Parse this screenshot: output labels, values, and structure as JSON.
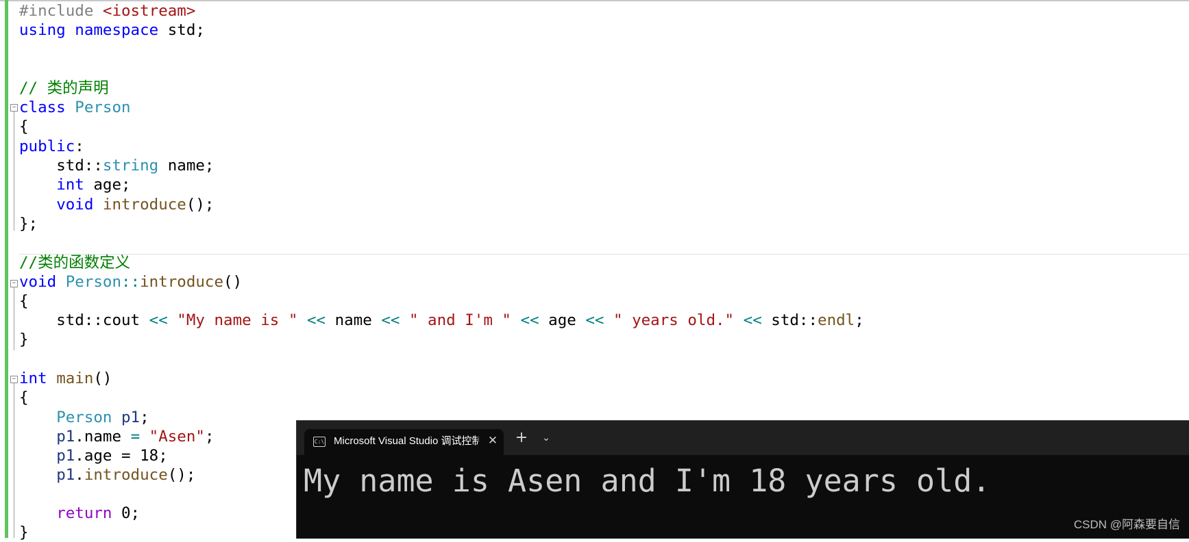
{
  "code": {
    "include_directive": "#include",
    "include_header": "<iostream>",
    "using_kw": "using",
    "namespace_kw": "namespace",
    "using_rest": " std;",
    "comment_decl": "// 类的声明",
    "class_kw": "class",
    "class_name": "Person",
    "brace_open": "{",
    "brace_close": "}",
    "class_end": "};",
    "public_kw": "public",
    "colon": ":",
    "std_prefix": "std::",
    "string_type": "string",
    "member_name": " name;",
    "int_kw": "int",
    "member_age": " age;",
    "void_kw": "void",
    "introduce_fn": "introduce",
    "call_parens": "();",
    "comment_def": "//类的函数定义",
    "scope_op": "::",
    "parens": "()",
    "cout_prefix": "std::cout ",
    "shift_op": "<<",
    "str_myname": "\"My name is \"",
    "name_ref": " name ",
    "str_and": "\" and I'm \"",
    "age_ref": " age ",
    "str_years": "\" years old.\"",
    "endl_fn": "endl",
    "semicolon": ";",
    "main_fn": "main",
    "obj_name": "p1",
    "member_name_access": ".name ",
    "assign_op": "=",
    "str_asen": "\"Asen\"",
    "member_age_access": ".age = 18;",
    "dot": ".",
    "return_kw": "return",
    "return_value": " 0;"
  },
  "console": {
    "tab_title": "Microsoft Visual Studio 调试控制台",
    "close_glyph": "✕",
    "new_tab_glyph": "+",
    "dropdown_glyph": "⌄",
    "output": "My name is Asen and I'm 18 years old."
  },
  "watermark": "CSDN @阿森要自信",
  "colors": {
    "keyword": "#0000ff",
    "type": "#2b91af",
    "function": "#74531f",
    "string": "#a31515",
    "comment": "#008000",
    "operator": "#008080",
    "preprocessor": "#808080",
    "variable": "#1f377f",
    "control": "#8f08c4",
    "change_bar": "#5ec45e",
    "console_bg": "#0c0c0c",
    "console_text": "#cccccc"
  }
}
